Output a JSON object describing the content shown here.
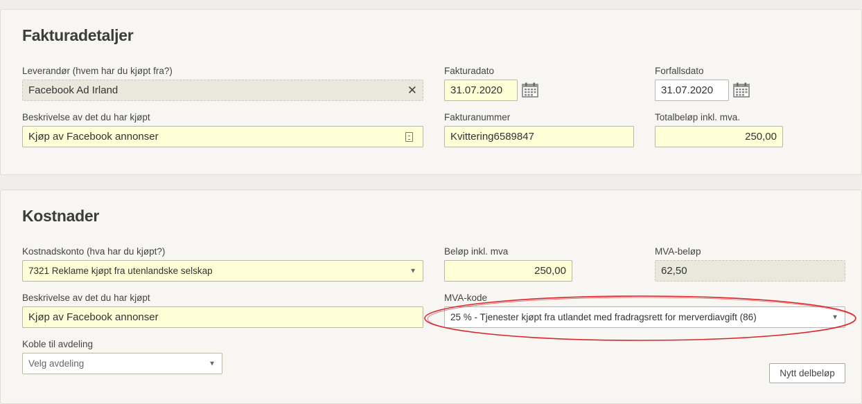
{
  "invoice_details": {
    "heading": "Fakturadetaljer",
    "supplier_label": "Leverandør (hvem har du kjøpt fra?)",
    "supplier_value": "Facebook Ad Irland",
    "invoice_date_label": "Fakturadato",
    "invoice_date_value": "31.07.2020",
    "due_date_label": "Forfallsdato",
    "due_date_value": "31.07.2020",
    "description_label": "Beskrivelse av det du har kjøpt",
    "description_value": "Kjøp av Facebook annonser",
    "invoice_number_label": "Fakturanummer",
    "invoice_number_value": "Kvittering6589847",
    "total_label": "Totalbeløp inkl. mva.",
    "total_value": "250,00"
  },
  "costs": {
    "heading": "Kostnader",
    "account_label": "Kostnadskonto (hva har du kjøpt?)",
    "account_value": "7321 Reklame kjøpt fra utenlandske selskap",
    "amount_label": "Beløp inkl. mva",
    "amount_value": "250,00",
    "vat_amount_label": "MVA-beløp",
    "vat_amount_value": "62,50",
    "description_label": "Beskrivelse av det du har kjøpt",
    "description_value": "Kjøp av Facebook annonser",
    "vat_code_label": "MVA-kode",
    "vat_code_value": "25 % - Tjenester kjøpt fra utlandet med fradragsrett for merverdiavgift (86)",
    "department_label": "Koble til avdeling",
    "department_placeholder": "Velg avdeling",
    "new_line_button": "Nytt delbeløp"
  },
  "icons": {
    "clear": "close-icon",
    "calendar": "calendar-icon",
    "document": "document-icon",
    "dropdown": "chevron-down-icon"
  },
  "colors": {
    "editable_field": "#fefed7",
    "readonly_field": "#e9e8dc",
    "highlight_oval": "#d9262b"
  }
}
